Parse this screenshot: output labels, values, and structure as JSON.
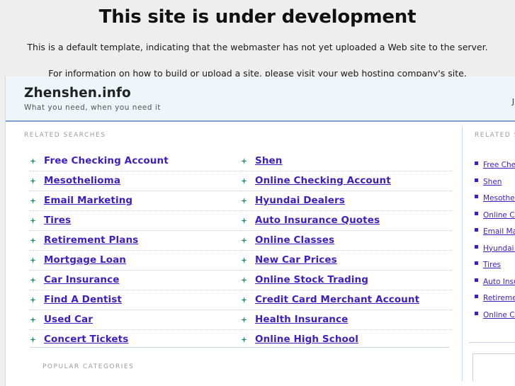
{
  "notice": {
    "title": "This site is under development",
    "line1": "This is a default template, indicating that the webmaster has not yet uploaded a Web site to the server.",
    "line2": "For information on how to build or upload a site, please visit your web hosting company's site."
  },
  "parked": {
    "header": {
      "site_title": "Zhenshen.info",
      "tagline": "What you need, when you need it",
      "nav_clipped": "Ju"
    },
    "main": {
      "section_label": "RELATED SEARCHES",
      "popular_label": "POPULAR CATEGORIES",
      "column_left": [
        {
          "label": "Free Checking Account",
          "underlined": false
        },
        {
          "label": "Mesothelioma",
          "underlined": true
        },
        {
          "label": "Email Marketing",
          "underlined": true
        },
        {
          "label": "Tires",
          "underlined": true
        },
        {
          "label": "Retirement Plans",
          "underlined": true
        },
        {
          "label": "Mortgage Loan",
          "underlined": true
        },
        {
          "label": "Car Insurance",
          "underlined": true
        },
        {
          "label": "Find A Dentist",
          "underlined": true
        },
        {
          "label": "Used Car",
          "underlined": true
        },
        {
          "label": "Concert Tickets",
          "underlined": true
        }
      ],
      "column_right": [
        {
          "label": "Shen",
          "underlined": true
        },
        {
          "label": "Online Checking Account",
          "underlined": true
        },
        {
          "label": "Hyundai Dealers",
          "underlined": true
        },
        {
          "label": "Auto Insurance Quotes",
          "underlined": true
        },
        {
          "label": "Online Classes",
          "underlined": true
        },
        {
          "label": "New Car Prices",
          "underlined": true
        },
        {
          "label": "Online Stock Trading",
          "underlined": true
        },
        {
          "label": "Credit Card Merchant Account",
          "underlined": true
        },
        {
          "label": "Health Insurance",
          "underlined": true
        },
        {
          "label": "Online High School",
          "underlined": true
        }
      ]
    },
    "sidebar": {
      "section_label": "RELATED SEARCHES",
      "items": [
        {
          "label": "Free Checking Account"
        },
        {
          "label": "Shen"
        },
        {
          "label": "Mesothelioma"
        },
        {
          "label": "Online Checking Account"
        },
        {
          "label": "Email Marketing"
        },
        {
          "label": "Hyundai Dealers"
        },
        {
          "label": "Tires"
        },
        {
          "label": "Auto Insurance Quotes"
        },
        {
          "label": "Retirement Plans"
        },
        {
          "label": "Online Classes"
        }
      ]
    }
  },
  "colors": {
    "page_background": "#eeeeee",
    "content_background": "#ffffff",
    "header_background": "#eff6fa",
    "header_border": "#7e9fd0",
    "link": "#3b1fc4",
    "bullet_star": "#2e8b74",
    "section_label": "#9a9a9a",
    "divider": "#c9d8ee",
    "row_dotted": "#c8d2e2"
  }
}
